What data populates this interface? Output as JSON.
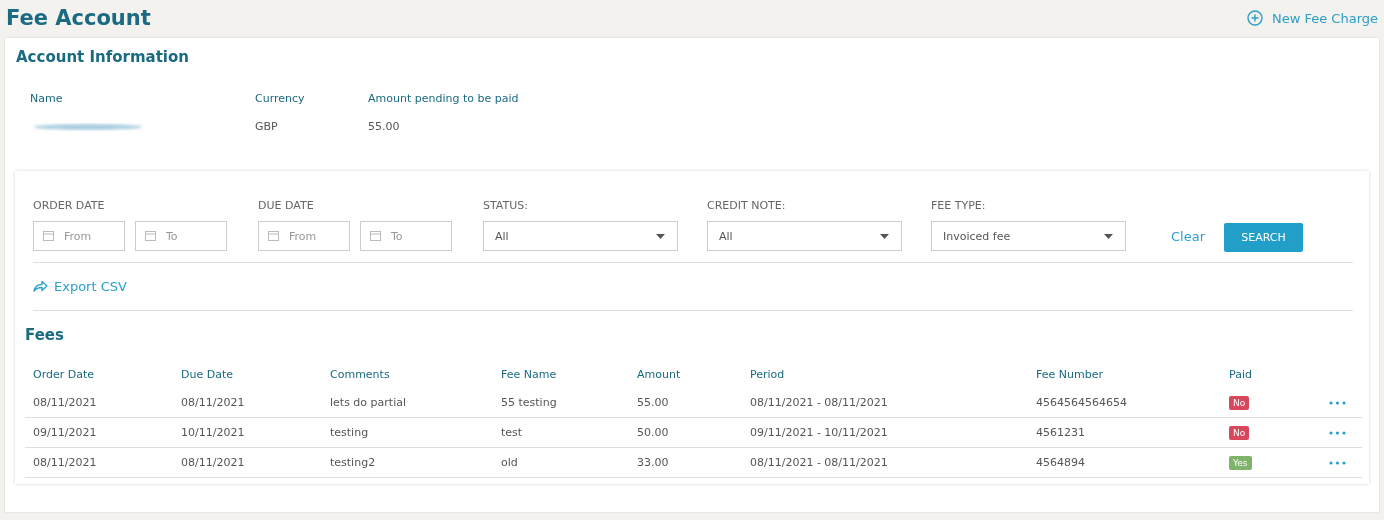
{
  "page_title": "Fee Account",
  "new_fee_link": "New Fee Charge",
  "account_info": {
    "title": "Account Information",
    "fields": [
      {
        "label": "Name",
        "redacted": true
      },
      {
        "label": "Currency",
        "redacted": false,
        "value": "GBP"
      },
      {
        "label": "Amount pending to be paid",
        "redacted": false,
        "value": "55.00"
      }
    ]
  },
  "filters": {
    "date_ranges": [
      {
        "label": "ORDER DATE",
        "from_placeholder": "From",
        "to_placeholder": "To"
      },
      {
        "label": "DUE DATE",
        "from_placeholder": "From",
        "to_placeholder": "To"
      }
    ],
    "selects": [
      {
        "label": "STATUS:",
        "value": "All"
      },
      {
        "label": "CREDIT NOTE:",
        "value": "All"
      },
      {
        "label": "FEE TYPE:",
        "value": "Invoiced fee"
      }
    ],
    "clear": "Clear",
    "search": "SEARCH"
  },
  "export_link": "Export CSV",
  "fees": {
    "title": "Fees",
    "columns": [
      "Order Date",
      "Due Date",
      "Comments",
      "Fee Name",
      "Amount",
      "Period",
      "Fee Number",
      "Paid"
    ],
    "rows": [
      {
        "cells": [
          "08/11/2021",
          "08/11/2021",
          "lets do partial",
          "55 testing",
          "55.00",
          "08/11/2021 - 08/11/2021",
          "4564564564654"
        ],
        "paid": false,
        "paid_label": "No"
      },
      {
        "cells": [
          "09/11/2021",
          "10/11/2021",
          "testing",
          "test",
          "50.00",
          "09/11/2021 - 10/11/2021",
          "4561231"
        ],
        "paid": false,
        "paid_label": "No"
      },
      {
        "cells": [
          "08/11/2021",
          "08/11/2021",
          "testing2",
          "old",
          "33.00",
          "08/11/2021 - 08/11/2021",
          "4564894"
        ],
        "paid": true,
        "paid_label": "Yes"
      }
    ]
  }
}
